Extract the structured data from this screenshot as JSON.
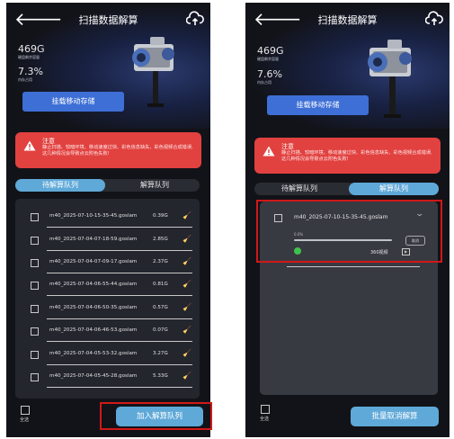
{
  "app": {
    "title": "扫描数据解算"
  },
  "stats": {
    "disk_value": "469G",
    "disk_label": "硬盘剩余容量",
    "mem_label": "内存占用"
  },
  "left": {
    "mem_value": "7.3%",
    "action_label": "加入解算队列"
  },
  "right": {
    "mem_value": "7.6%",
    "action_label": "批量取消解算",
    "task": {
      "file": "m40_2025-07-10-15-35-45.goslam",
      "progress_text": "0.0%",
      "progress": 0.0,
      "cancel_label": "取消",
      "video_label": "360视频"
    }
  },
  "mount_button": "挂载移动存储",
  "notice": {
    "title": "注意",
    "body": "静止扫描、较暗环境、移动速度过快、彩色信息缺失、彩色视频合成错误,这几种情况会导致点云附色失败!"
  },
  "tabs": {
    "pending": "待解算队列",
    "processing": "解算队列"
  },
  "select_all": "全选",
  "files": [
    {
      "name": "m40_2025-07-10-15-35-45.goslam",
      "size": "0.39G"
    },
    {
      "name": "m40_2025-07-04-07-18-59.goslam",
      "size": "2.85G"
    },
    {
      "name": "m40_2025-07-04-07-09-17.goslam",
      "size": "2.37G"
    },
    {
      "name": "m40_2025-07-04-06-55-44.goslam",
      "size": "0.81G"
    },
    {
      "name": "m40_2025-07-04-06-50-35.goslam",
      "size": "0.57G"
    },
    {
      "name": "m40_2025-07-04-06-46-53.goslam",
      "size": "0.07G"
    },
    {
      "name": "m40_2025-07-04-05-53-32.goslam",
      "size": "3.27G"
    },
    {
      "name": "m40_2025-07-04-05-45-28.goslam",
      "size": "5.33G"
    }
  ],
  "colors": {
    "accent": "#5fa9d8",
    "mount": "#3e6fd6",
    "notice": "#e1413f",
    "highlight": "#d01818",
    "progress": "#39c14a"
  },
  "icons": {
    "back": "arrow-left-icon",
    "upload": "cloud-upload-icon",
    "warning": "warning-icon",
    "delete": "broom-icon",
    "expand": "chevron-down-icon",
    "play": "play-icon"
  }
}
